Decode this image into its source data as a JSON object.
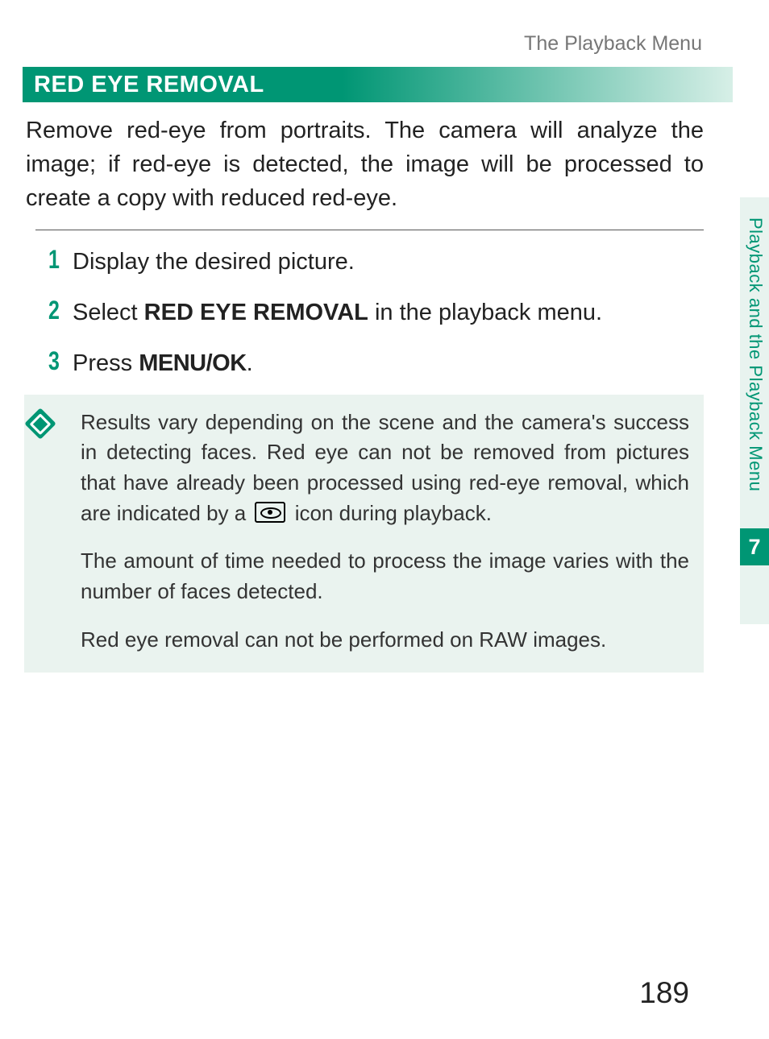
{
  "breadcrumb": "The Playback Menu",
  "section_heading": "RED EYE REMOVAL",
  "intro": "Remove red-eye from portraits. The camera will analyze the image; if red-eye is detected, the image will be processed to create a copy with reduced red-eye.",
  "steps": [
    {
      "num": "1",
      "text": "Display the desired picture."
    },
    {
      "num": "2",
      "prefix": "Select ",
      "bold": "RED EYE REMOVAL",
      "suffix": " in the playback menu."
    },
    {
      "num": "3",
      "prefix": "Press ",
      "bold": "MENU/OK",
      "suffix": "."
    }
  ],
  "notes": {
    "p1a": "Results vary depending on the scene and the camera's success in detecting faces. Red eye can not be removed from pictures that have already been processed using red-eye removal, which are indicated by a ",
    "p1b": " icon during playback.",
    "p2": "The amount of time needed to process the image varies with the number of faces detected.",
    "p3": "Red eye removal can not be performed on RAW images."
  },
  "side_label": "Playback and the Playback Menu",
  "chapter_number": "7",
  "page_number": "189"
}
